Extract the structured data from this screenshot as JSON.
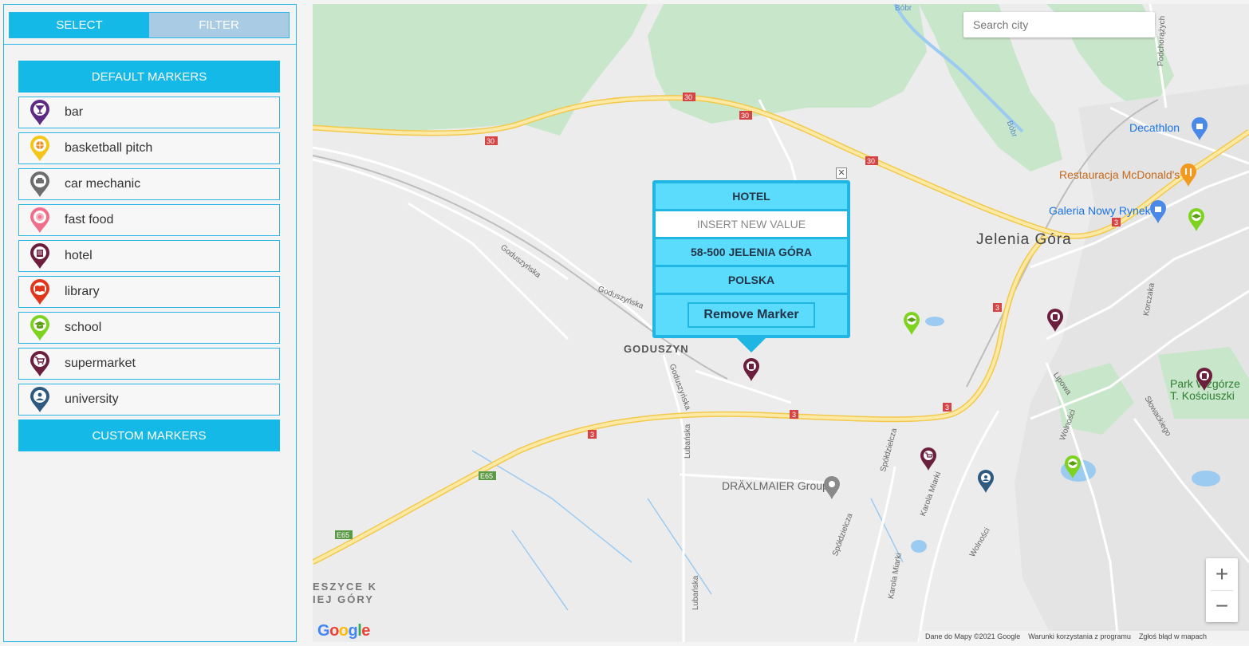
{
  "sidebar": {
    "tabs": [
      {
        "label": "SELECT",
        "active": true
      },
      {
        "label": "FILTER",
        "active": false
      }
    ],
    "default_markers_label": "DEFAULT MARKERS",
    "custom_markers_label": "CUSTOM MARKERS",
    "markers": [
      {
        "label": "bar",
        "color": "#5e2a84",
        "icon": "cocktail-icon"
      },
      {
        "label": "basketball pitch",
        "color": "#f5c518",
        "icon": "basketball-icon"
      },
      {
        "label": "car mechanic",
        "color": "#6d6d6d",
        "icon": "car-icon"
      },
      {
        "label": "fast food",
        "color": "#f06e8a",
        "icon": "food-icon"
      },
      {
        "label": "hotel",
        "color": "#6b1f3d",
        "icon": "hotel-icon"
      },
      {
        "label": "library",
        "color": "#e2361c",
        "icon": "book-icon"
      },
      {
        "label": "school",
        "color": "#7ed321",
        "icon": "graduation-cap-icon"
      },
      {
        "label": "supermarket",
        "color": "#6b1f3d",
        "icon": "cart-icon"
      },
      {
        "label": "university",
        "color": "#2e5a82",
        "icon": "student-icon"
      }
    ]
  },
  "map": {
    "search_placeholder": "Search city",
    "popup": {
      "title": "HOTEL",
      "input_placeholder": "INSERT NEW VALUE",
      "address": "58-500 JELENIA GÓRA",
      "country": "POLSKA",
      "remove_label": "Remove Marker",
      "close_symbol": "✕"
    },
    "labels": {
      "city": "Jelenia Góra",
      "goduszyn": "GODUSZYN",
      "draxlmaier": "DRÄXLMAIER Group",
      "decathlon": "Decathlon",
      "mcdonalds": "Restauracja McDonald's",
      "galeria": "Galeria Nowy Rynek",
      "park1": "Park Wzgórze",
      "park2": "T. Kościuszki",
      "cieszyce1": "ESZYCE K",
      "cieszyce2": "IEJ GÓRY",
      "goduszynska1": "Goduszyńska",
      "goduszynska2": "Goduszyńska",
      "goduszynska3": "Goduszyńska",
      "lubanska1": "Lubańska",
      "lubanska2": "Lubańska",
      "spoldzielcza1": "Spółdzielcza",
      "spoldzielcza2": "Spółdzielcza",
      "karola_miarki1": "Karola Miarki",
      "karola_miarki2": "Karola Miarki",
      "wolnosci1": "Wolności",
      "wolnosci2": "Wolności",
      "lipowa": "Lipowa",
      "slowackiego": "Słowackiego",
      "korczaka": "Korczaka",
      "podchorazych": "Podchorążych",
      "bobr1": "Bóbr",
      "bobr2": "Bóbr",
      "road30": "30",
      "road3": "3",
      "e65": "E65"
    },
    "zoom": {
      "in": "+",
      "out": "−"
    },
    "footer": {
      "data": "Dane do Mapy ©2021 Google",
      "terms": "Warunki korzystania z programu",
      "report": "Zgłoś błąd w mapach"
    },
    "google_logo": [
      "G",
      "o",
      "o",
      "g",
      "l",
      "e"
    ]
  }
}
